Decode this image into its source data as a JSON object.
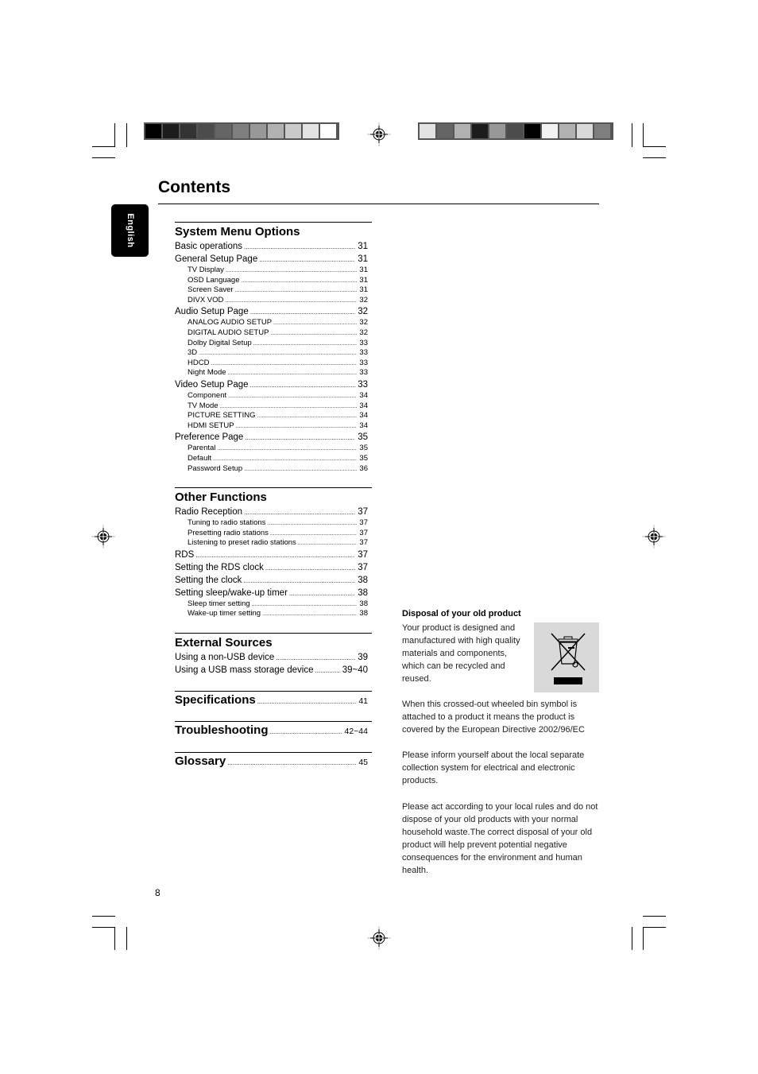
{
  "page": {
    "title": "Contents",
    "language_tab": "English",
    "page_number": "8"
  },
  "print_marks": {
    "left_colorbar": [
      "#000000",
      "#1c1c1c",
      "#333333",
      "#4c4c4c",
      "#656565",
      "#7e7e7e",
      "#989898",
      "#b1b1b1",
      "#cacaca",
      "#e3e3e3",
      "#ffffff"
    ],
    "right_colorbar": [
      "#e3e3e3",
      "#656565",
      "#b1b1b1",
      "#1c1c1c",
      "#989898",
      "#4c4c4c",
      "#000000",
      "#f2f2f2",
      "#b1b1b1",
      "#d9d9d9",
      "#7e7e7e"
    ]
  },
  "toc": {
    "system_menu": {
      "title": "System Menu Options",
      "entries": [
        {
          "level": 1,
          "label": "Basic operations",
          "page": "31"
        },
        {
          "level": 1,
          "label": "General Setup Page",
          "page": "31"
        },
        {
          "level": 2,
          "label": "TV Display",
          "page": "31"
        },
        {
          "level": 2,
          "label": "OSD Language",
          "page": "31"
        },
        {
          "level": 2,
          "label": "Screen Saver",
          "page": "31"
        },
        {
          "level": 2,
          "label": "DIVX VOD",
          "page": "32"
        },
        {
          "level": 1,
          "label": "Audio Setup Page",
          "page": "32"
        },
        {
          "level": 2,
          "label": "ANALOG AUDIO SETUP",
          "page": "32"
        },
        {
          "level": 2,
          "label": "DIGITAL AUDIO SETUP",
          "page": "32"
        },
        {
          "level": 2,
          "label": "Dolby Digital Setup",
          "page": "33"
        },
        {
          "level": 2,
          "label": "3D",
          "page": "33"
        },
        {
          "level": 2,
          "label": "HDCD",
          "page": "33"
        },
        {
          "level": 2,
          "label": "Night Mode",
          "page": "33"
        },
        {
          "level": 1,
          "label": "Video Setup Page",
          "page": "33"
        },
        {
          "level": 2,
          "label": "Component",
          "page": "34"
        },
        {
          "level": 2,
          "label": "TV Mode",
          "page": "34"
        },
        {
          "level": 2,
          "label": "PICTURE SETTING",
          "page": "34"
        },
        {
          "level": 2,
          "label": "HDMI SETUP",
          "page": "34"
        },
        {
          "level": 1,
          "label": "Preference Page",
          "page": "35"
        },
        {
          "level": 2,
          "label": "Parental",
          "page": "35"
        },
        {
          "level": 2,
          "label": "Default",
          "page": "35"
        },
        {
          "level": 2,
          "label": "Password Setup",
          "page": "36"
        }
      ]
    },
    "other_functions": {
      "title": "Other Functions",
      "entries": [
        {
          "level": 1,
          "label": "Radio Reception",
          "page": "37"
        },
        {
          "level": 2,
          "label": "Tuning to radio stations",
          "page": "37"
        },
        {
          "level": 2,
          "label": "Presetting radio stations",
          "page": "37"
        },
        {
          "level": 2,
          "label": "Listening to preset radio stations",
          "page": "37"
        },
        {
          "level": 1,
          "label": "RDS",
          "page": "37"
        },
        {
          "level": 1,
          "label": "Setting the RDS clock",
          "page": "37"
        },
        {
          "level": 1,
          "label": "Setting the clock",
          "page": "38"
        },
        {
          "level": 1,
          "label": "Setting sleep/wake-up timer",
          "page": "38"
        },
        {
          "level": 2,
          "label": "Sleep timer setting",
          "page": "38"
        },
        {
          "level": 2,
          "label": "Wake-up timer setting",
          "page": "38"
        }
      ]
    },
    "external_sources": {
      "title": "External Sources",
      "entries": [
        {
          "level": 1,
          "label": "Using a non-USB device",
          "page": "39"
        },
        {
          "level": 1,
          "label": "Using a USB mass storage device",
          "page": "39~40"
        }
      ]
    },
    "specifications": {
      "label": "Specifications",
      "page": "41"
    },
    "troubleshooting": {
      "label": "Troubleshooting",
      "page": "42~44"
    },
    "glossary": {
      "label": "Glossary",
      "page": "45"
    }
  },
  "disposal": {
    "title": "Disposal of  your old product",
    "intro_lines": [
      "Your product is designed and",
      "manufactured with high quality",
      "materials and components,",
      "which can be recycled and",
      "reused."
    ],
    "p1": "When this crossed-out wheeled bin symbol is attached to a product it means the product is covered by the European Directive 2002/96/EC",
    "p2": "Please inform yourself about the local separate collection system for electrical and electronic products.",
    "p3": "Please act according to your local rules and do not dispose of your old products with your normal household waste.The correct disposal of your old product will help prevent potential negative consequences for the environment and human health.",
    "icon": "crossed-out-wheeled-bin-icon"
  }
}
